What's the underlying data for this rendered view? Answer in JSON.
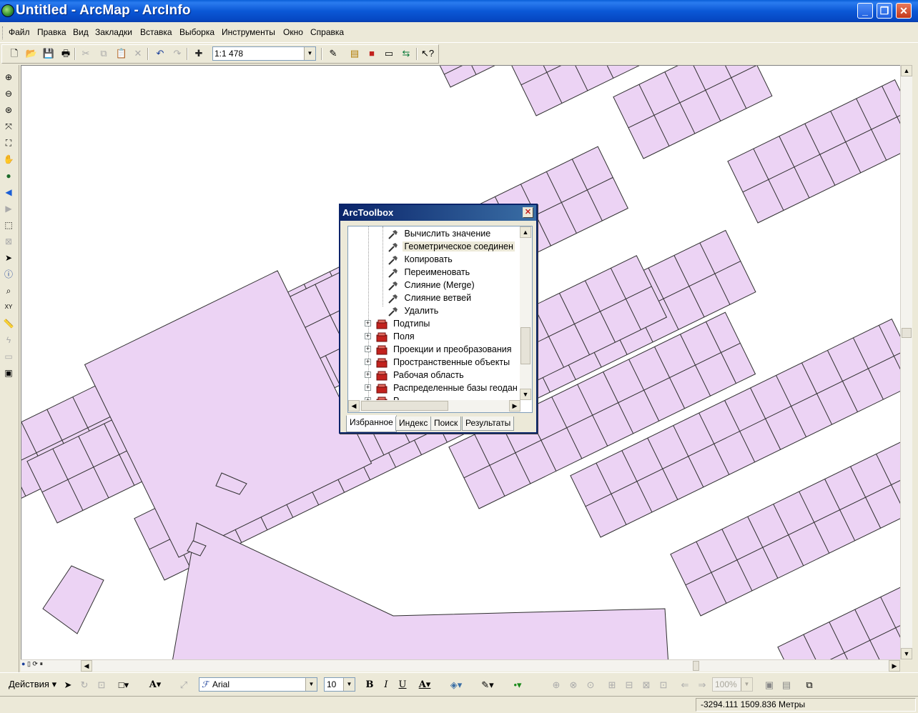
{
  "window": {
    "title": "Untitled - ArcMap - ArcInfo",
    "minimize": "_",
    "restore": "❐",
    "close": "✕"
  },
  "menu": [
    "Файл",
    "Правка",
    "Вид",
    "Закладки",
    "Вставка",
    "Выборка",
    "Инструменты",
    "Окно",
    "Справка"
  ],
  "standard_toolbar": {
    "scale": "1:1 478",
    "icons": [
      "new-document",
      "open",
      "save",
      "print",
      "cut",
      "copy",
      "paste",
      "delete",
      "undo",
      "redo",
      "add-data",
      "editor-toolbar",
      "arccatalog",
      "arctoolbox",
      "command-line",
      "model-builder",
      "whats-this-help"
    ]
  },
  "tools_toolbar": {
    "icons": [
      "zoom-in",
      "zoom-out",
      "fixed-zoom-in",
      "fixed-zoom-out",
      "full-extent",
      "pan",
      "globe",
      "back-extent",
      "forward-extent",
      "select-features",
      "clear-selection",
      "select-elements",
      "identify",
      "find",
      "go-to-xy",
      "measure",
      "hyperlink",
      "html-popup",
      "time-slider"
    ]
  },
  "colors": {
    "parcel_fill": "#ecd3f4",
    "parcel_stroke": "#2f2f2f",
    "titlebar": "#0b58d6",
    "toolbox_title": "#0a246a",
    "chrome": "#ece9d8"
  },
  "toolbox": {
    "title": "ArcToolbox",
    "tools": [
      "Вычислить значение",
      "Геометрическое соединен",
      "Копировать",
      "Переименовать",
      "Слияние (Merge)",
      "Слияние ветвей",
      "Удалить"
    ],
    "selected_tool": "Геометрическое соединен",
    "toolsets": [
      "Подтипы",
      "Поля",
      "Проекции и преобразования",
      "Пространственные объекты",
      "Рабочая область",
      "Распределенные базы геодан",
      "Р..."
    ],
    "tabs": [
      "Избранное",
      "Индекс",
      "Поиск",
      "Результаты"
    ],
    "active_tab": "Избранное"
  },
  "drawing_toolbar": {
    "actions_label": "Действия ▾",
    "font": "Arial",
    "font_size": "10",
    "bold": "B",
    "italic": "I",
    "underline": "U",
    "zoom_percent": "100%",
    "icons": [
      "select-elements-arrow",
      "rotate",
      "zoom-to-selected",
      "new-rectangle",
      "new-text",
      "callout",
      "font-color",
      "fill-color",
      "line-color",
      "marker-color",
      "group",
      "ungroup",
      "order",
      "nudge",
      "align",
      "distribute",
      "rotate-flip",
      "previous-page",
      "next-page",
      "focus-data-frame",
      "change-layout",
      "data-driven-pages"
    ]
  },
  "status": {
    "coordinates": "-3294.111  1509.836 Метры"
  }
}
